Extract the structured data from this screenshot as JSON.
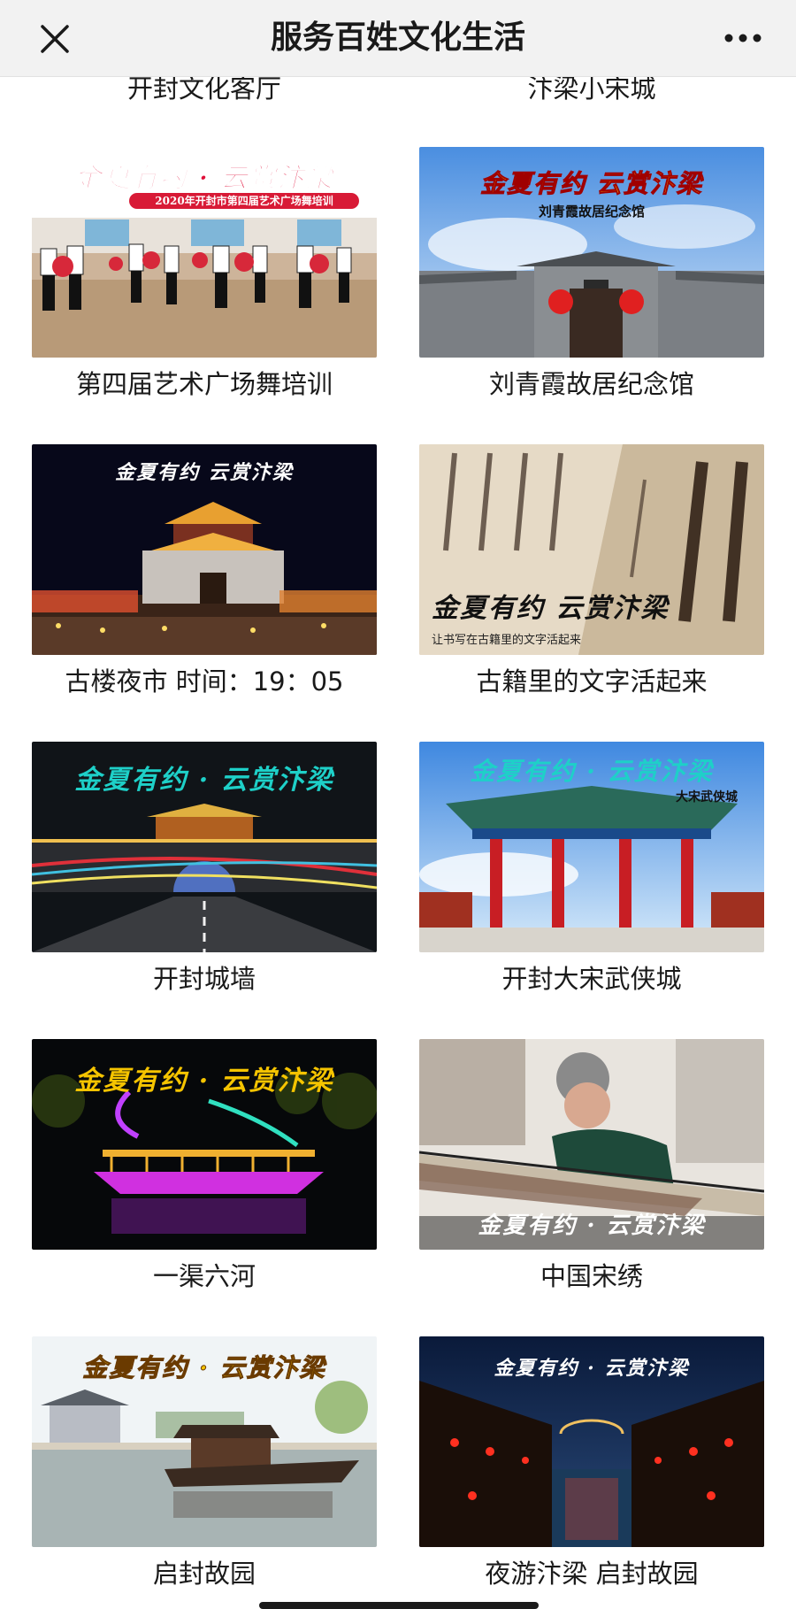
{
  "nav": {
    "title": "服务百姓文化生活"
  },
  "previous_row": [
    "开封文化客厅",
    "汴梁小宋城"
  ],
  "brand_overlay": "金夏有约 · 云赏汴梁",
  "brand_overlay_spaced": "金夏有约  云赏汴梁",
  "cards": [
    {
      "caption": "第四届艺术广场舞培训",
      "overlay_sub": "2020年开封市第四届艺术广场舞培训"
    },
    {
      "caption": "刘青霞故居纪念馆",
      "overlay_sub": "刘青霞故居纪念馆"
    },
    {
      "caption": "古楼夜市 时间：19：05"
    },
    {
      "caption": "古籍里的文字活起来",
      "overlay_sub": "让书写在古籍里的文字活起来"
    },
    {
      "caption": "开封城墙"
    },
    {
      "caption": "开封大宋武侠城",
      "overlay_sub": "大宋武侠城"
    },
    {
      "caption": "一渠六河"
    },
    {
      "caption": "中国宋绣"
    },
    {
      "caption": "启封故园"
    },
    {
      "caption": "夜游汴梁 启封故园"
    }
  ],
  "colors": {
    "navbar_bg": "#f2f2f2",
    "title_red": "#e0103a",
    "title_gold": "#f5c400",
    "title_cyan": "#1ed0c8"
  }
}
